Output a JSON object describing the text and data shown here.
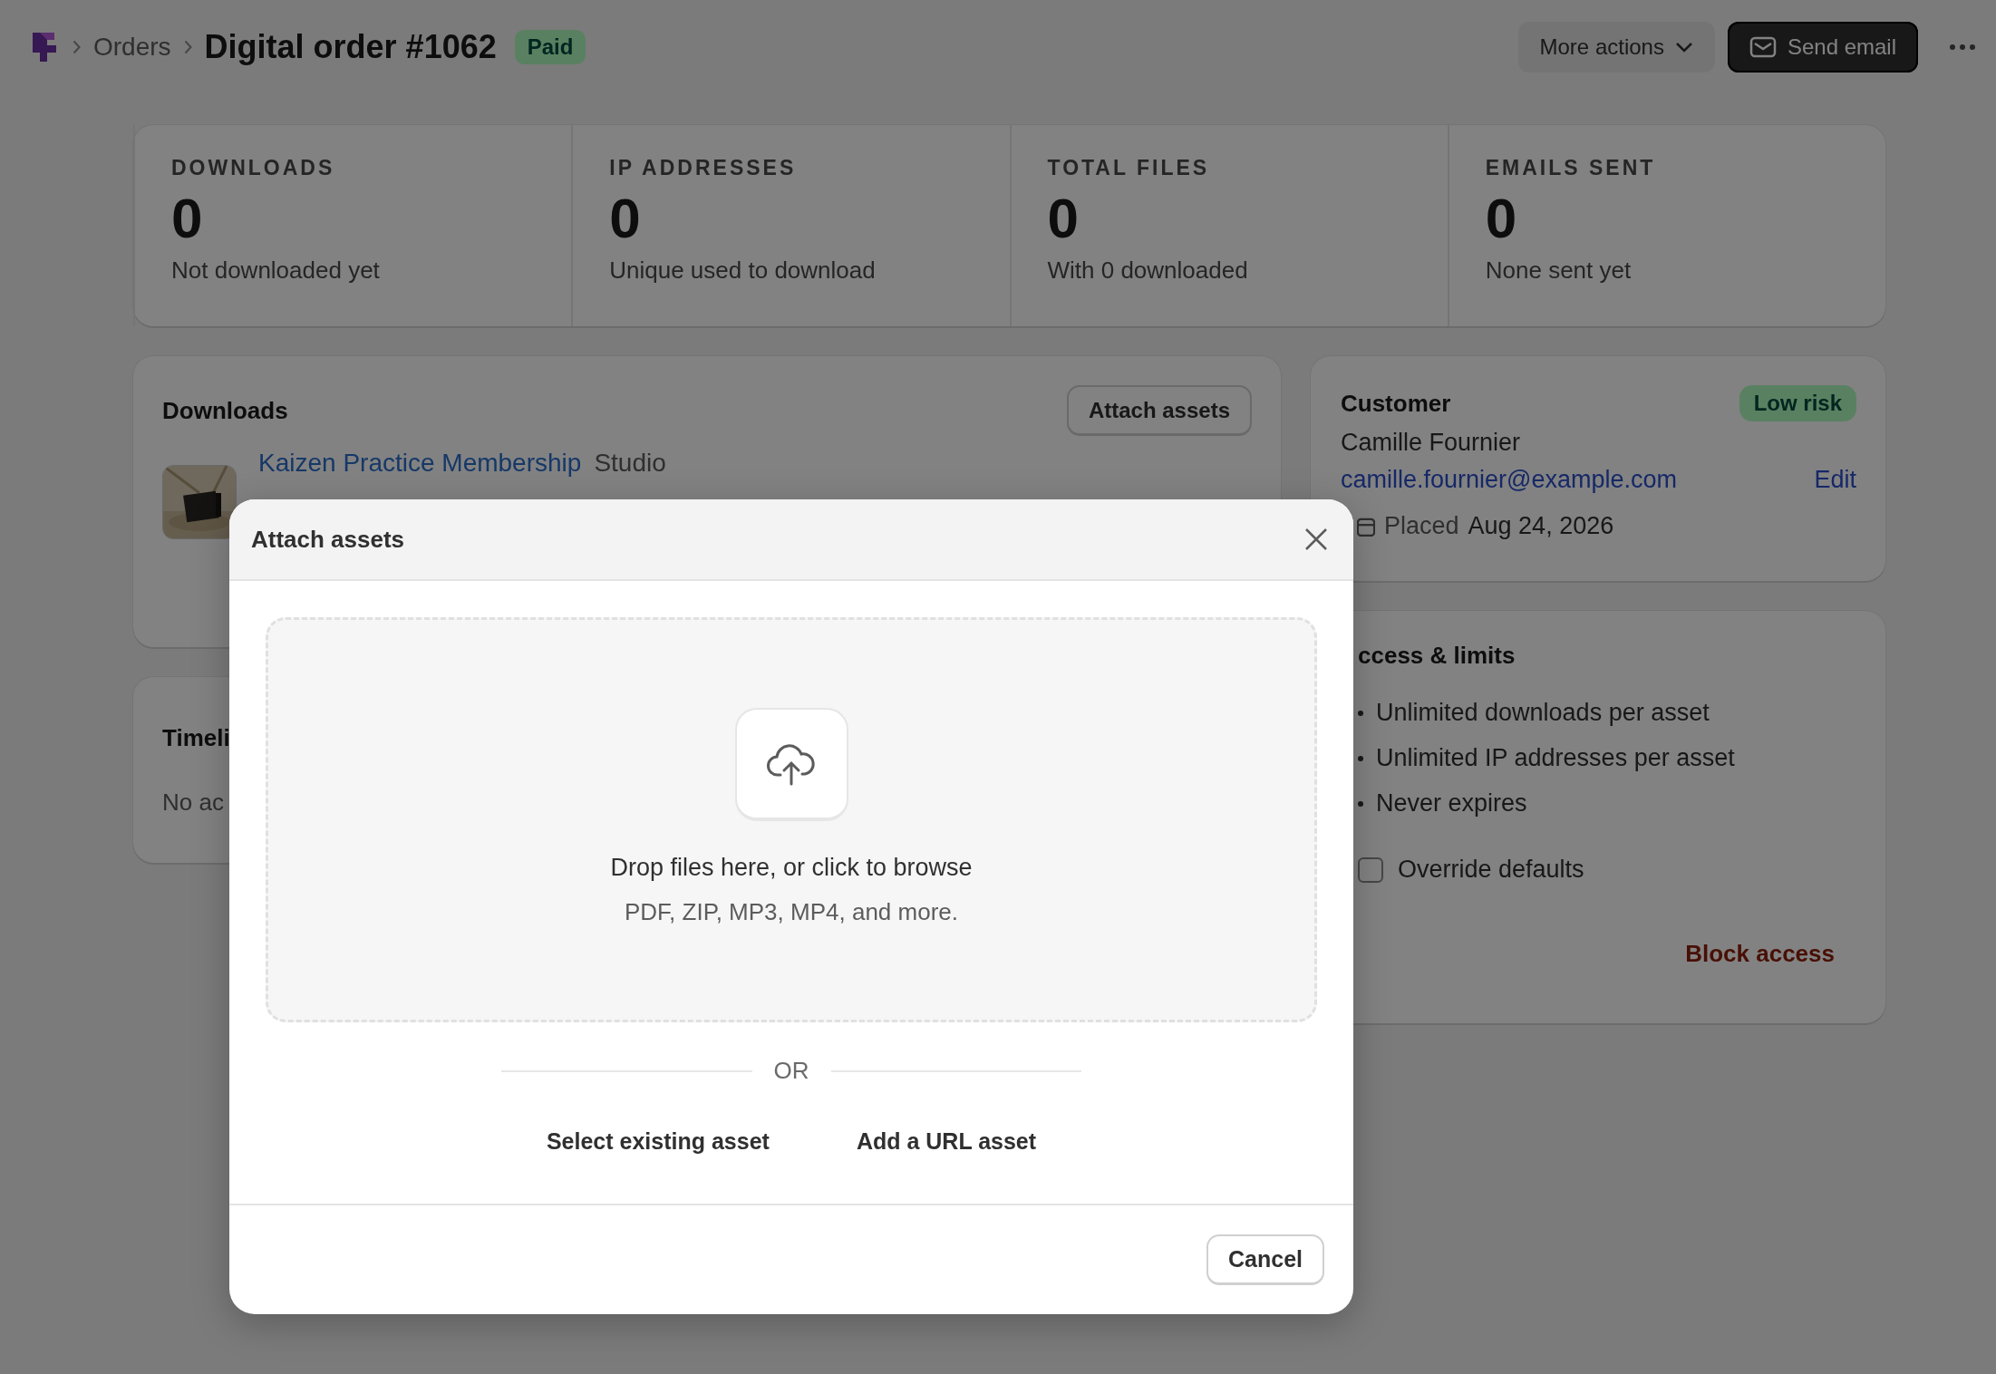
{
  "breadcrumb": {
    "parent": "Orders",
    "title": "Digital order #1062",
    "status": "Paid"
  },
  "header_actions": {
    "more": "More actions",
    "send": "Send email"
  },
  "stats": [
    {
      "label": "DOWNLOADS",
      "value": "0",
      "note": "Not downloaded yet"
    },
    {
      "label": "IP ADDRESSES",
      "value": "0",
      "note": "Unique used to download"
    },
    {
      "label": "TOTAL FILES",
      "value": "0",
      "note": "With 0 downloaded"
    },
    {
      "label": "EMAILS SENT",
      "value": "0",
      "note": "None sent yet"
    }
  ],
  "downloads": {
    "title": "Downloads",
    "button": "Attach assets",
    "item": {
      "name": "Kaizen Practice Membership",
      "variant": "Studio"
    }
  },
  "timeline": {
    "title": "Timeli",
    "text": "No ac"
  },
  "customer": {
    "title": "Customer",
    "risk": "Low risk",
    "name": "Camille Fournier",
    "email": "camille.fournier@example.com",
    "edit": "Edit",
    "placed_label": "Placed",
    "placed_date": "Aug 24, 2026"
  },
  "access": {
    "title": "ccess & limits",
    "limits": [
      "Unlimited downloads per asset",
      "Unlimited IP addresses per asset",
      "Never expires"
    ],
    "override": {
      "label": "Override defaults",
      "checked": false
    },
    "block": "Block access"
  },
  "modal": {
    "title": "Attach assets",
    "drop_title": "Drop files here, or click to browse",
    "drop_hint": "PDF, ZIP, MP3, MP4, and more.",
    "divider": "OR",
    "actions": [
      "Select existing asset",
      "Add a URL asset"
    ],
    "cancel": "Cancel"
  }
}
